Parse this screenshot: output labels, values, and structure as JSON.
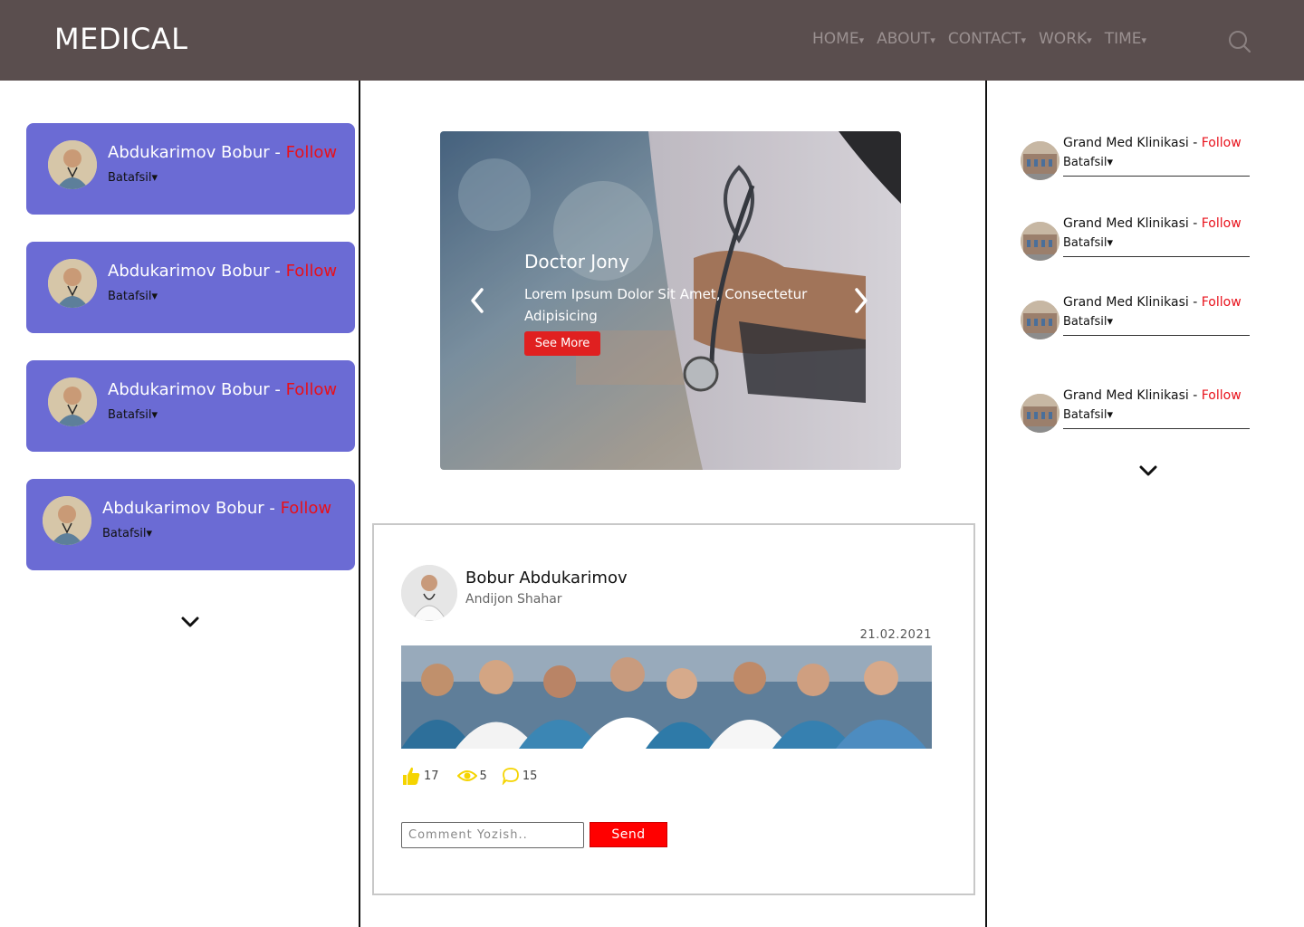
{
  "header": {
    "logo": "MEDICAL",
    "nav": [
      {
        "label": "HOME",
        "caret": "▾"
      },
      {
        "label": "ABOUT",
        "caret": "▾"
      },
      {
        "label": "CONTACT",
        "caret": "▾"
      },
      {
        "label": "WORK",
        "caret": "▾"
      },
      {
        "label": "TIME",
        "caret": "▾"
      }
    ],
    "search_icon": "search-icon"
  },
  "left_list": {
    "items": [
      {
        "name": "Abdukarimov Bobur",
        "separator": " - ",
        "follow": "Follow",
        "details": "Batafsil▾"
      },
      {
        "name": "Abdukarimov Bobur",
        "separator": " - ",
        "follow": "Follow",
        "details": "Batafsil▾"
      },
      {
        "name": "Abdukarimov Bobur",
        "separator": " - ",
        "follow": "Follow",
        "details": "Batafsil▾"
      },
      {
        "name": "Abdukarimov Bobur",
        "separator": " - ",
        "follow": "Follow",
        "details": "Batafsil▾"
      }
    ],
    "more_icon": "chevron-down-icon"
  },
  "slider": {
    "title": "Doctor Jony",
    "text": "Lorem Ipsum Dolor Sit Amet, Consectetur Adipisicing",
    "button": "See More",
    "prev_icon": "chevron-left-icon",
    "next_icon": "chevron-right-icon"
  },
  "post": {
    "author": "Bobur Abdukarimov",
    "location": "Andijon Shahar",
    "date": "21.02.2021",
    "likes": "17",
    "views": "5",
    "comments": "15",
    "comment_placeholder": "Comment Yozish..",
    "send_label": "Send"
  },
  "right_list": {
    "items": [
      {
        "name": "Grand Med Klinikasi",
        "separator": " - ",
        "follow": "Follow",
        "details": "Batafsil▾"
      },
      {
        "name": "Grand Med Klinikasi",
        "separator": " - ",
        "follow": "Follow",
        "details": "Batafsil▾"
      },
      {
        "name": "Grand Med Klinikasi",
        "separator": " - ",
        "follow": "Follow",
        "details": "Batafsil▾"
      },
      {
        "name": "Grand Med Klinikasi",
        "separator": " - ",
        "follow": "Follow",
        "details": "Batafsil▾"
      }
    ],
    "more_icon": "chevron-down-icon"
  },
  "colors": {
    "header_bg": "#5a4e4e",
    "card_bg": "#6b6bd4",
    "follow": "#e8101a",
    "accent_red": "#e02020",
    "stat_icon": "#f5d400"
  }
}
